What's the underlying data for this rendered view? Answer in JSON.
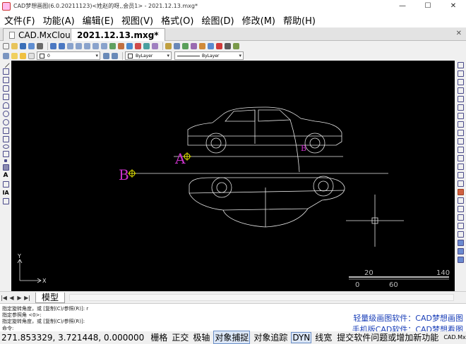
{
  "window": {
    "title": "CAD梦想画图(6.0.20211123)<姓赵的呀,,会员1> - 2021.12.13.mxg*",
    "min_label": "—",
    "max_label": "☐",
    "close_label": "✕"
  },
  "menubar": {
    "items": [
      "文件(F)",
      "功能(A)",
      "编辑(E)",
      "视图(V)",
      "格式(O)",
      "绘图(D)",
      "修改(M)",
      "帮助(H)"
    ]
  },
  "tabs": {
    "items": [
      "CAD.MxCloud",
      "2021.12.13.mxg*"
    ],
    "close_label": "✕"
  },
  "layer_toolbar": {
    "layer_value": "0",
    "color_value": "ByLayer",
    "linetype_value": "ByLayer"
  },
  "canvas": {
    "label_a": "A",
    "label_b": "B",
    "axis_y": "Y",
    "axis_x": "X",
    "scale_20": "20",
    "scale_140": "140",
    "scale_0": "0",
    "scale_60": "60"
  },
  "model_tab": {
    "label": "模型"
  },
  "command": {
    "lines": [
      "指定旋转角度，或 [复制(C)/参照(R)]: r",
      "指定参照角 <0>:",
      "指定旋转角度，或 [复制(C)/参照(R)]:"
    ],
    "prompt": "命令:",
    "promo1": "轻量级画图软件：CAD梦想画图",
    "promo2": "手机版CAD软件：CAD梦想看图"
  },
  "status": {
    "coords": "271.853329,  3.721448,  0.000000",
    "toggles": [
      "栅格",
      "正交",
      "极轴",
      "对象捕捉",
      "对象追踪",
      "DYN",
      "线宽"
    ],
    "feedback": "提交软件问题或增加新功能",
    "logo": "CAD.MxCloud"
  },
  "colors": {
    "canvas": "#000000",
    "label_magenta": "#cc33cc",
    "snap_yellow": "#ffff00",
    "promo_blue": "#1a3fb8"
  }
}
